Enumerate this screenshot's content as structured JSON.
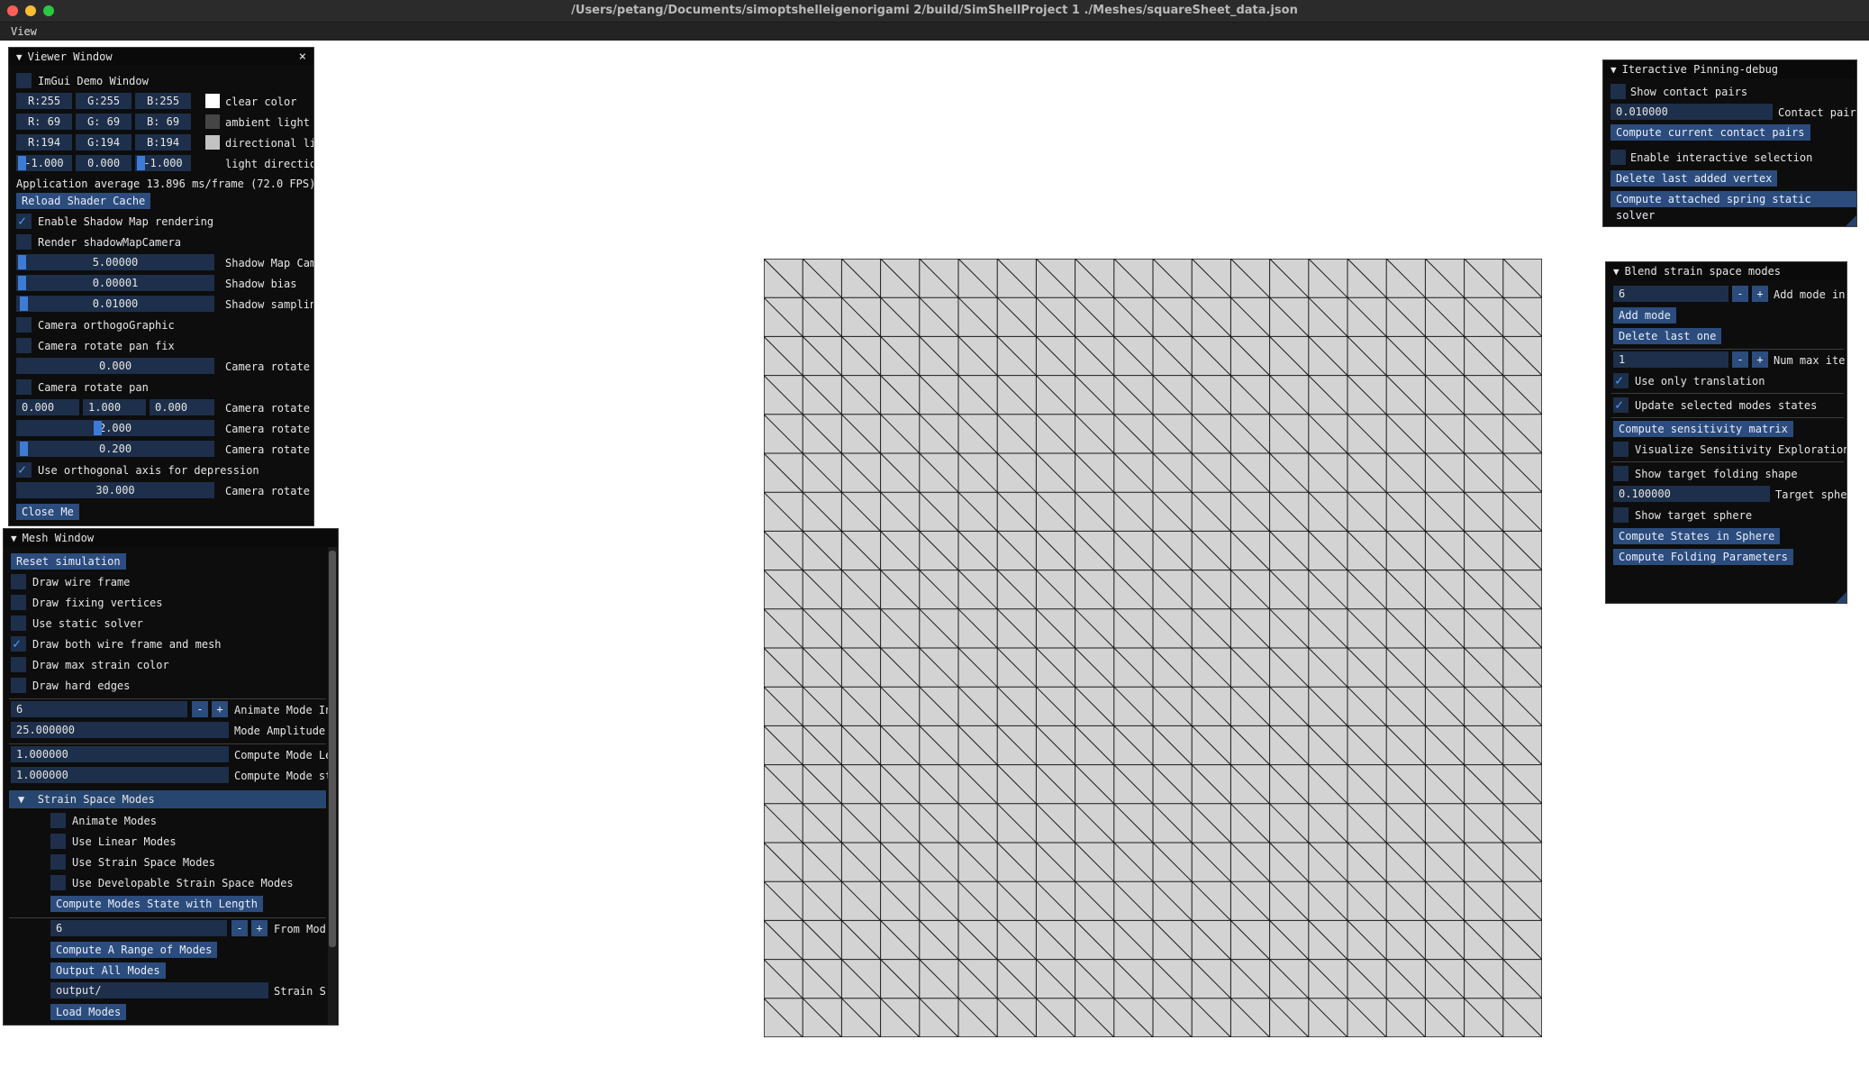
{
  "window": {
    "title": "/Users/petang/Documents/simoptshelleigenorigami 2/build/SimShellProject 1 ./Meshes/squareSheet_data.json",
    "traffic_colors": [
      "#ff5f57",
      "#febc2e",
      "#28c840"
    ]
  },
  "menu": {
    "view_label": "View"
  },
  "viewer": {
    "title": "Viewer Window",
    "close_glyph": "×",
    "demo_window": "ImGui Demo Window",
    "clear_color": {
      "r": "R:255",
      "g": "G:255",
      "b": "B:255",
      "label": "clear color",
      "swatch": "#ffffff"
    },
    "ambient_light": {
      "r": "R: 69",
      "g": "G: 69",
      "b": "B: 69",
      "label": "ambient light",
      "swatch": "#454545"
    },
    "directional_light": {
      "r": "R:194",
      "g": "G:194",
      "b": "B:194",
      "label": "directional lig",
      "swatch": "#c2c2c2"
    },
    "light_direction": {
      "x": "-1.000",
      "y": "0.000",
      "z": "-1.000",
      "label": "light direction"
    },
    "fps_text": "Application average 13.896 ms/frame (72.0 FPS)",
    "reload_shader": "Reload Shader Cache",
    "enable_shadow": "Enable Shadow Map rendering",
    "render_shadow_camera": "Render shadowMapCamera",
    "shadow_map_camera": {
      "value": "5.00000",
      "label": "Shadow Map Came"
    },
    "shadow_bias": {
      "value": "0.00001",
      "label": "Shadow bias"
    },
    "shadow_sampling": {
      "value": "0.01000",
      "label": "Shadow sampling"
    },
    "camera_ortho": "Camera orthogoGraphic",
    "camera_rotate_pan_fix": "Camera rotate pan fix",
    "camera_rotate_p1": {
      "value": "0.000",
      "label": "Camera rotate p"
    },
    "camera_rotate_pan": "Camera rotate pan",
    "camera_rotate_p2": {
      "x": "0.000",
      "y": "1.000",
      "z": "0.000",
      "label": "Camera rotate p"
    },
    "camera_rotate_p3": {
      "value": "2.000",
      "label": "Camera rotate p"
    },
    "camera_rotate_p4": {
      "value": "0.200",
      "label": "Camera rotate p"
    },
    "use_orthogonal": "Use orthogonal axis for depression",
    "camera_rotate_p5": {
      "value": "30.000",
      "label": "Camera rotate p"
    },
    "close_me": "Close Me"
  },
  "mesh_window": {
    "title": "Mesh Window",
    "reset_simulation": "Reset simulation",
    "draw_wire_frame": "Draw wire frame",
    "draw_fixing_vertices": "Draw fixing vertices",
    "use_static_solver": "Use static solver",
    "draw_both": "Draw both wire frame and mesh",
    "draw_max_strain": "Draw max strain color",
    "draw_hard_edges": "Draw hard edges",
    "animate_mode": {
      "value": "6",
      "minus": "-",
      "plus": "+",
      "label": "Animate Mode In"
    },
    "mode_amplitude": {
      "value": "25.000000",
      "label": "Mode Amplitude"
    },
    "compute_mode_le": {
      "value": "1.000000",
      "label": "Compute Mode Le"
    },
    "compute_mode_st": {
      "value": "1.000000",
      "label": "Compute Mode st"
    },
    "strain_space_header": "Strain Space Modes",
    "animate_modes": "Animate Modes",
    "use_linear_modes": "Use Linear Modes",
    "use_strain_space_modes": "Use Strain Space Modes",
    "use_developable": "Use Developable Strain Space Modes",
    "compute_modes_state": "Compute Modes State with Length",
    "from_mode": {
      "value": "6",
      "minus": "-",
      "plus": "+",
      "label": "From Mod"
    },
    "compute_range": "Compute A Range of Modes",
    "output_all": "Output All Modes",
    "output_path": {
      "value": "output/",
      "label": "Strain S"
    },
    "load_modes": "Load Modes"
  },
  "pinning": {
    "title": "Iteractive Pinning-debug",
    "show_contact_pairs": "Show contact pairs",
    "contact_pair": {
      "value": "0.010000",
      "label": "Contact pair"
    },
    "compute_contact": "Compute current contact pairs",
    "enable_selection": "Enable interactive selection",
    "delete_vertex": "Delete last added vertex",
    "compute_spring": "Compute attached spring static solver"
  },
  "blend": {
    "title": "Blend strain space modes",
    "add_mode_index": {
      "value": "6",
      "minus": "-",
      "plus": "+",
      "label": "Add mode in"
    },
    "add_mode": "Add mode",
    "delete_last": "Delete last one",
    "num_max_iter": {
      "value": "1",
      "minus": "-",
      "plus": "+",
      "label": "Num max iter"
    },
    "use_only_translation": "Use only translation",
    "update_selected": "Update selected modes states",
    "compute_sensitivity": "Compute sensitivity matrix",
    "visualize_sensitivity": "Visualize Sensitivity Exploration",
    "show_target_folding": "Show target folding shape",
    "target_sphere": {
      "value": "0.100000",
      "label": "Target spher"
    },
    "show_target_sphere": "Show target sphere",
    "compute_states_sphere": "Compute States in Sphere",
    "compute_folding": "Compute Folding Parameters"
  },
  "mesh_grid": {
    "rows": 20,
    "cols": 20,
    "fill": "#d3d3d3",
    "line": "#1a1a1a"
  }
}
